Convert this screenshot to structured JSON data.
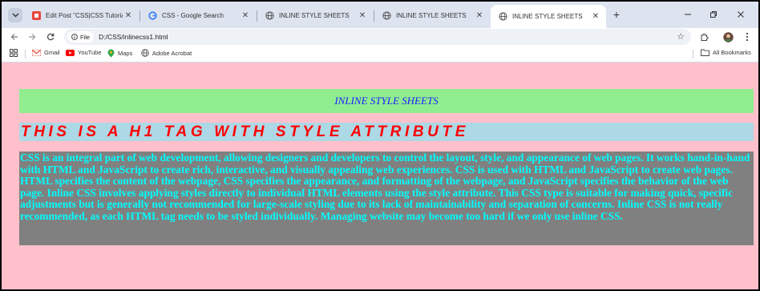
{
  "browser": {
    "tabs": [
      {
        "title": "Edit Post \"CSS|CSS Tutorial| CSS",
        "favicon": "blogger-icon",
        "active": false
      },
      {
        "title": "CSS - Google Search",
        "favicon": "google-icon",
        "active": false
      },
      {
        "title": "INLINE STYLE SHEETS",
        "favicon": "globe-icon",
        "active": false
      },
      {
        "title": "INLINE STYLE SHEETS",
        "favicon": "globe-icon",
        "active": false
      },
      {
        "title": "INLINE STYLE SHEETS",
        "favicon": "globe-icon",
        "active": true
      }
    ],
    "new_tab_label": "+",
    "site_info_label": "File",
    "url": "D:/CSS/inlinecss1.html",
    "bookmarks": [
      {
        "label": "Gmail",
        "icon": "gmail-icon"
      },
      {
        "label": "YouTube",
        "icon": "youtube-icon"
      },
      {
        "label": "Maps",
        "icon": "maps-icon"
      },
      {
        "label": "Adobe Acrobat",
        "icon": "globe-icon"
      }
    ],
    "all_bookmarks_label": "All Bookmarks"
  },
  "page": {
    "banner_text": "INLINE STYLE SHEETS",
    "heading": "THIS IS A H1 TAG WITH STYLE ATTRIBUTE",
    "paragraph": "CSS is an integral part of web development, allowing designers and developers to control the layout, style, and appearance of web pages. It works hand-in-hand with HTML and JavaScript to create rich, interactive, and visually appealing web experiences. CSS is used with HTML and JavaScript to create web pages. HTML specifies the content of the webpage, CSS specifies the appearance, and formatting of the webpage, and JavaScript specifies the behavior of the web page. Inline CSS involves applying styles directly to individual HTML elements using the style attribute. This CSS type is suitable for making quick, specific adjustments but is generally not recommended for large-scale styling due to its lack of maintainability and separation of concerns. Inline CSS is not really recommended, as each HTML tag needs to be styled individually. Managing website may become too hard if we only use inline CSS."
  },
  "colors": {
    "page_background": "#ffc0cb",
    "banner_background": "#90ee90",
    "banner_text": "#1a1aff",
    "heading_background": "#add8e6",
    "heading_text": "#ff0000",
    "paragraph_background": "#808080",
    "paragraph_text": "#00ffff"
  }
}
